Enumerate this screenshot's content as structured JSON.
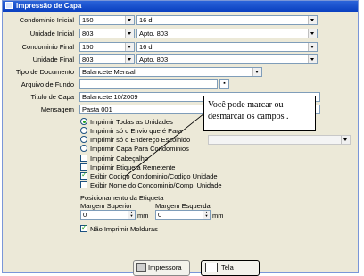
{
  "window": {
    "title": "Impressão de Capa"
  },
  "fields": {
    "condominio_inicial": {
      "label": "Condominio Inicial",
      "code": "150",
      "name": "16 d"
    },
    "unidade_inicial": {
      "label": "Unidade Inicial",
      "code": "803",
      "name": "Apto. 803"
    },
    "condominio_final": {
      "label": "Condominio Final",
      "code": "150",
      "name": "16 d"
    },
    "unidade_final": {
      "label": "Unidade Final",
      "code": "803",
      "name": "Apto. 803"
    },
    "tipo_documento": {
      "label": "Tipo de Documento",
      "value": "Balancete Mensal"
    },
    "arquivo_fundo": {
      "label": "Arquivo de Fundo",
      "value": ""
    },
    "titulo_capa": {
      "label": "Titulo de Capa",
      "value": "Balancete 10/2009"
    },
    "mensagem": {
      "label": "Mensagem",
      "value": "Pasta 001"
    }
  },
  "options": {
    "radios": [
      {
        "label": "Imprimir Todas as Unidades",
        "checked": true
      },
      {
        "label": "Imprimir só o Envio que é Para",
        "checked": false
      },
      {
        "label": "Imprimir só o Endereço Escolhido",
        "checked": false
      },
      {
        "label": "Imprimir Capa Para Condominios",
        "checked": false
      }
    ],
    "checks": [
      {
        "label": "Imprimir Cabeçalho",
        "checked": false
      },
      {
        "label": "Imprimir Etiqueta Remetente",
        "checked": false
      },
      {
        "label": "Exibir Codigo Condominio/Codigo Unidade",
        "checked": true
      },
      {
        "label": "Exibir Nome do Condominio/Comp. Unidade",
        "checked": false
      }
    ]
  },
  "etiqueta": {
    "heading": "Posicionamento da Etiqueta",
    "margem_superior_label": "Margem Superior",
    "margem_esquerda_label": "Margem Esquerda",
    "margem_superior_value": "0",
    "margem_esquerda_value": "0",
    "unit": "mm",
    "nao_imprimir_molduras": {
      "label": "Não Imprimir Molduras",
      "checked": true
    }
  },
  "callout": {
    "text": "Você pode marcar ou desmarcar os campos ."
  },
  "buttons": {
    "impressora": "Impressora",
    "tela": "Tela"
  }
}
